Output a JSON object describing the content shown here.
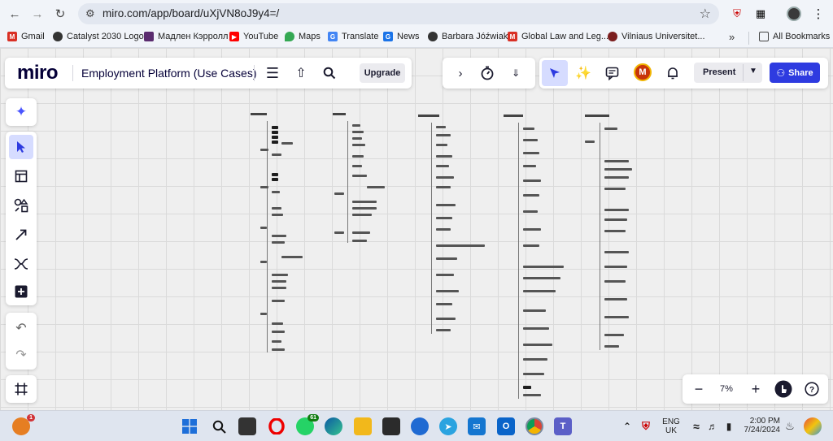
{
  "browser": {
    "url": "miro.com/app/board/uXjVN8oJ9y4=/",
    "bookmarks": [
      {
        "label": "Gmail",
        "color": "#d93025"
      },
      {
        "label": "Catalyst 2030 Logo",
        "color": "#333333"
      },
      {
        "label": "Мадлен Кэрролл",
        "color": "#5b2c6f"
      },
      {
        "label": "YouTube",
        "color": "#ff0000"
      },
      {
        "label": "Maps",
        "color": "#34a853"
      },
      {
        "label": "Translate",
        "color": "#4285f4"
      },
      {
        "label": "News",
        "color": "#1a73e8"
      },
      {
        "label": "Barbara Jóźwiak",
        "color": "#333333"
      },
      {
        "label": "Global Law and Leg...",
        "color": "#d93025"
      },
      {
        "label": "Vilniaus Universitet...",
        "color": "#7b1e1e"
      }
    ],
    "all_bookmarks": "All Bookmarks"
  },
  "miro": {
    "logo": "miro",
    "board_title": "Employment Platform (Use Cases)",
    "upgrade_label": "Upgrade",
    "avatar_initial": "M",
    "present_label": "Present",
    "share_label": "Share",
    "zoom_level": "7%",
    "accent_color": "#2e3be0"
  },
  "taskbar": {
    "notification_count": "1",
    "whatsapp_count": "61",
    "language": "ENG",
    "region": "UK",
    "time": "2:00 PM",
    "date": "7/24/2024"
  }
}
